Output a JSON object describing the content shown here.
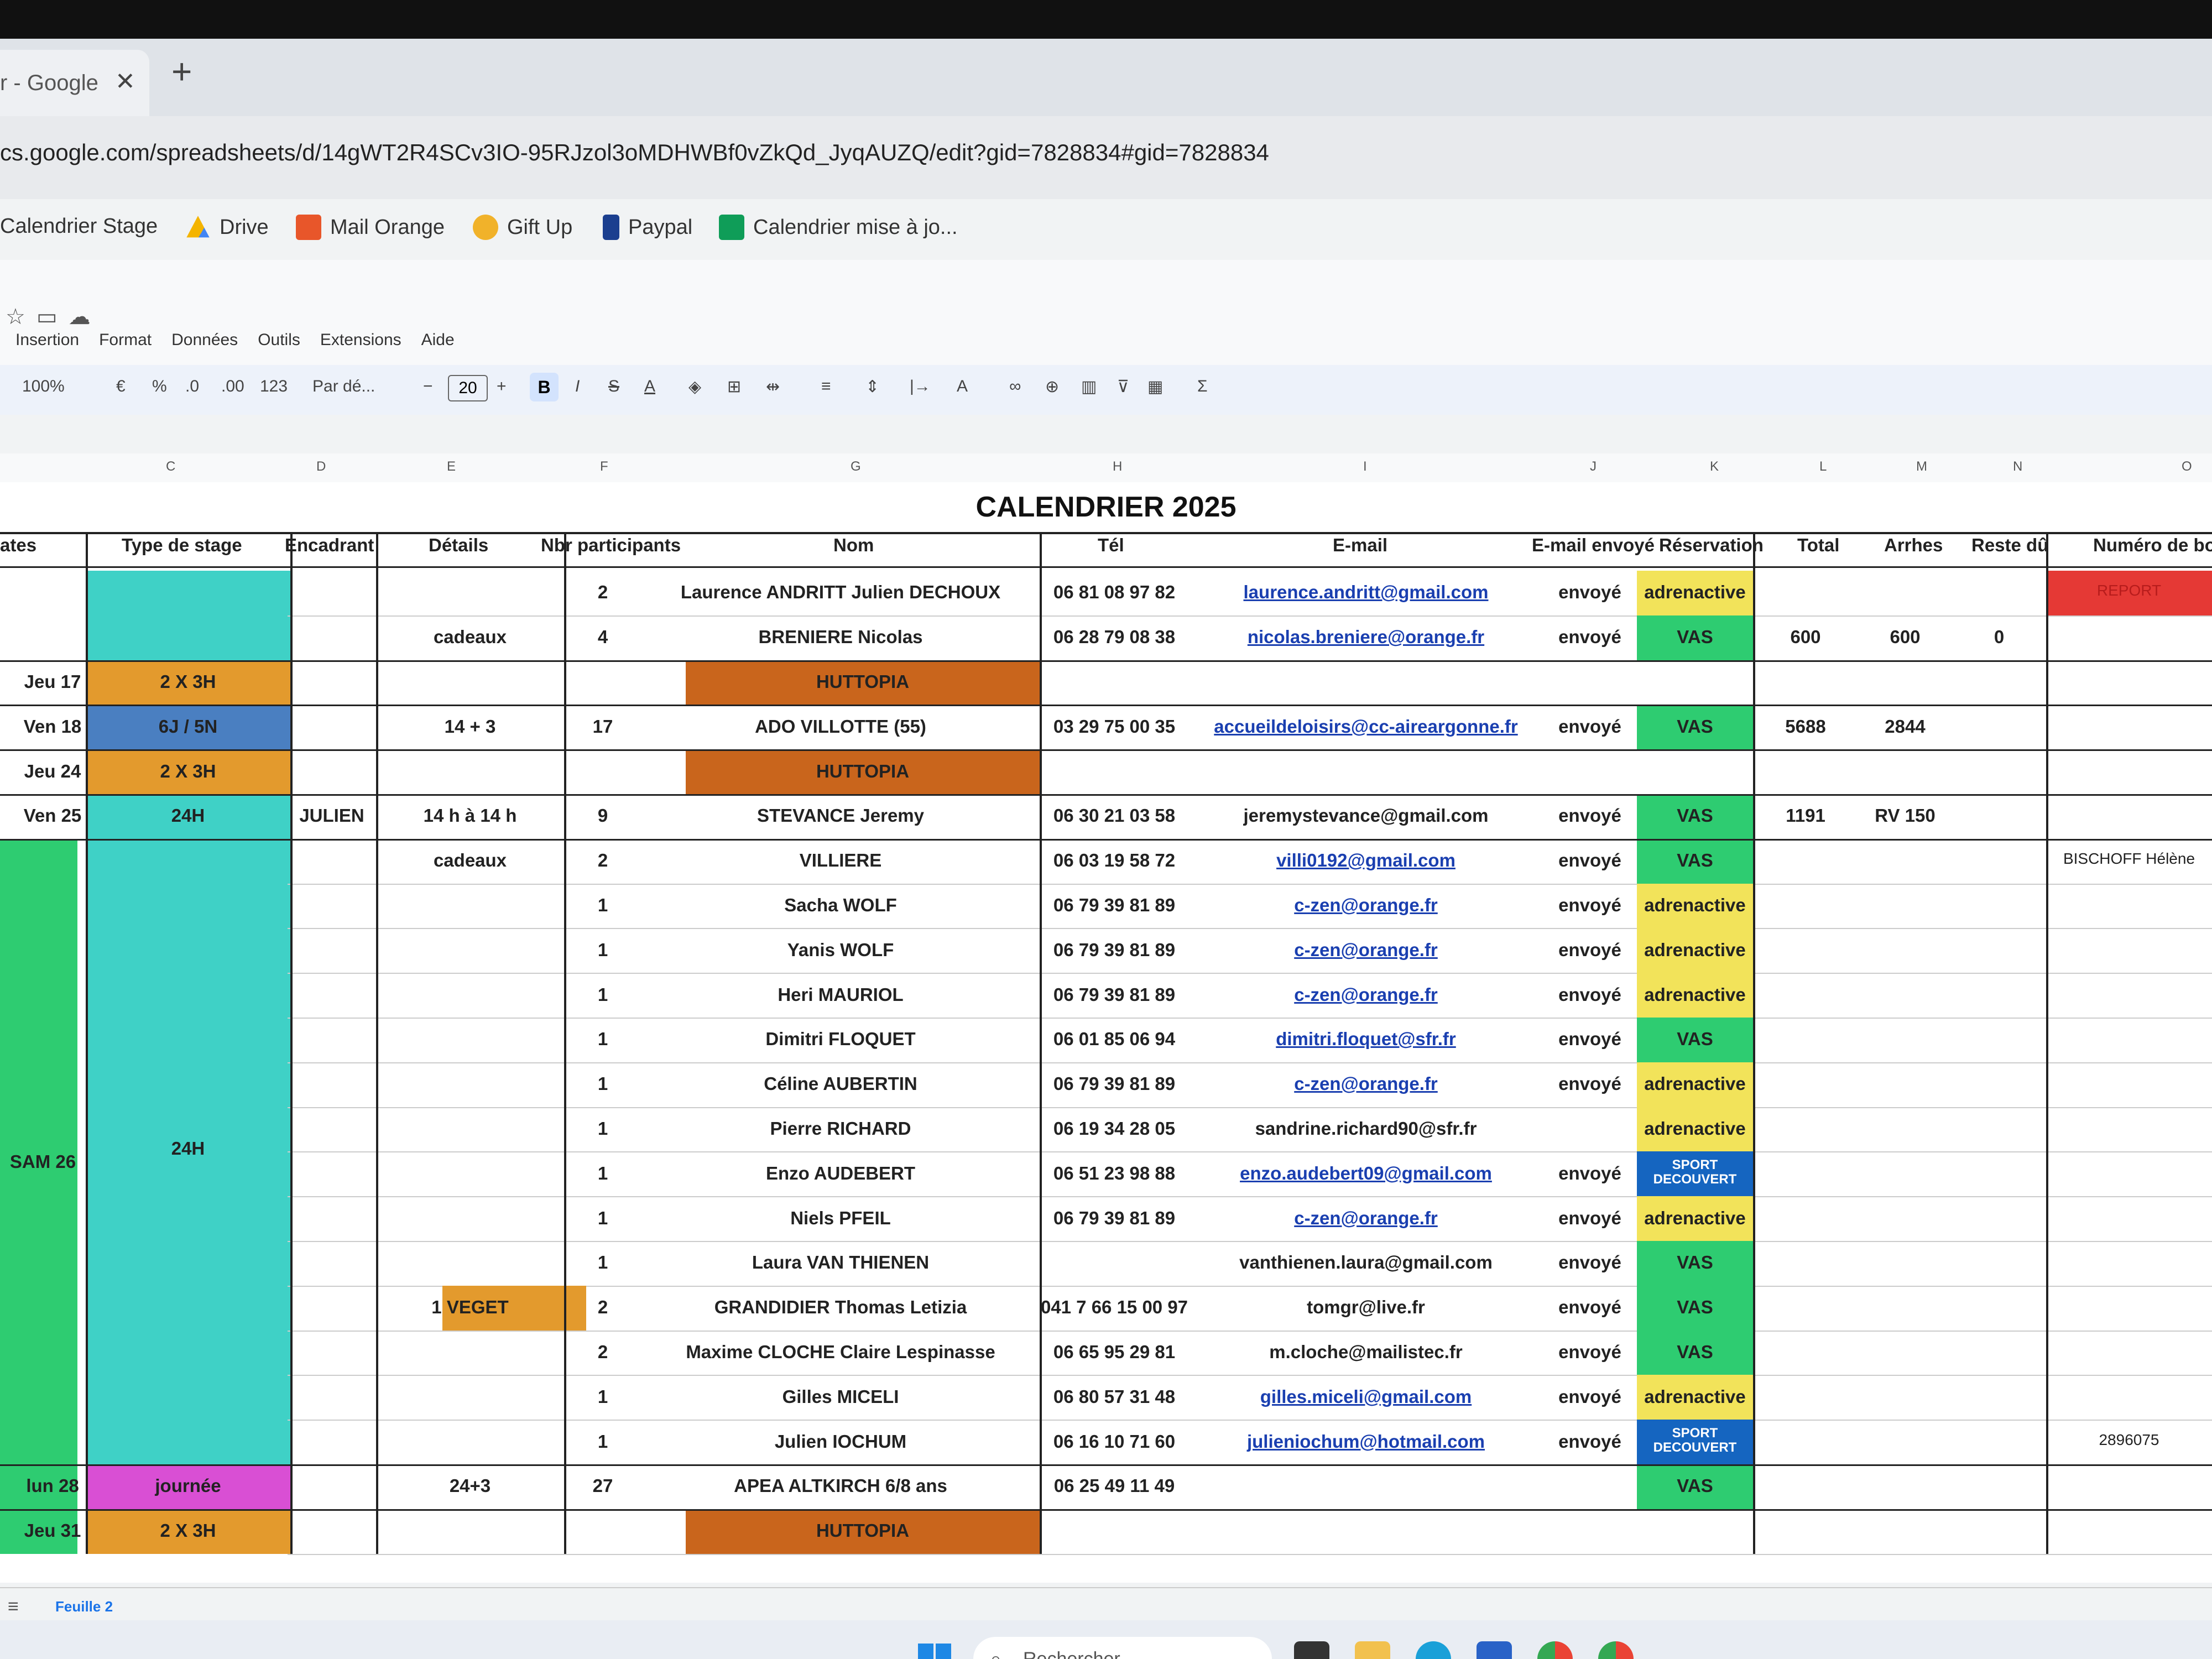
{
  "browser": {
    "tab_title": "r - Google",
    "tab_close": "✕",
    "new_tab": "+",
    "url": "cs.google.com/spreadsheets/d/14gWT2R4SCv3IO-95RJzol3oMDHWBf0vZkQd_JyqAUZQ/edit?gid=7828834#gid=7828834",
    "bookmarks": [
      "Calendrier Stage",
      "Drive",
      "Mail Orange",
      "Gift Up",
      "Paypal",
      "Calendrier mise à jo..."
    ]
  },
  "sheets": {
    "menus": [
      "Insertion",
      "Format",
      "Données",
      "Outils",
      "Extensions",
      "Aide"
    ],
    "toolbar": {
      "zoom": "100%",
      "currency": "€",
      "percent": "%",
      "dec_less": ".0",
      "dec_more": ".00",
      "number_format": "123",
      "font": "Par dé...",
      "minus": "−",
      "font_size": "20",
      "plus": "+",
      "bold": "B",
      "italic": "I",
      "strike": "S",
      "textcolor": "A",
      "sigma": "Σ"
    },
    "column_letters": [
      "C",
      "D",
      "E",
      "F",
      "G",
      "H",
      "I",
      "J",
      "K",
      "L",
      "M",
      "N",
      "O"
    ],
    "title": "CALENDRIER 2025",
    "headers": {
      "dates": "ates",
      "type": "Type de stage",
      "encadrant": "Encadrant",
      "details": "Détails",
      "nbr": "Nbr participants",
      "nom": "Nom",
      "tel": "Tél",
      "email": "E-mail",
      "envoye": "E-mail envoyé",
      "reservation": "Réservation",
      "total": "Total",
      "arrhes": "Arrhes",
      "reste": "Reste dû",
      "bon": "Numéro de bon"
    },
    "rows": [
      {
        "nbr": "2",
        "nom": "Laurence ANDRITT Julien DECHOUX",
        "tel": "06 81 08 97 82",
        "email": "laurence.andritt@gmail.com",
        "envoye": "envoyé",
        "resa": "adrenactive",
        "bon": "REPORT"
      },
      {
        "details": "cadeaux",
        "nbr": "4",
        "nom": "BRENIERE Nicolas",
        "tel": "06 28 79 08 38",
        "email": "nicolas.breniere@orange.fr",
        "envoye": "envoyé",
        "resa": "VAS",
        "total": "600",
        "arrhes": "600",
        "reste": "0"
      },
      {
        "date": "Jeu 17",
        "type": "2 X 3H",
        "nom": "HUTTOPIA"
      },
      {
        "date": "Ven 18",
        "type": "6J / 5N",
        "details": "14 + 3",
        "nbr": "17",
        "nom": "ADO VILLOTTE (55)",
        "tel": "03 29 75 00 35",
        "email": "accueildeloisirs@cc-aireargonne.fr",
        "envoye": "envoyé",
        "resa": "VAS",
        "total": "5688",
        "arrhes": "2844"
      },
      {
        "date": "Jeu 24",
        "type": "2 X 3H",
        "nom": "HUTTOPIA"
      },
      {
        "date": "Ven 25",
        "type": "24H",
        "encadrant": "JULIEN",
        "details": "14 h à 14 h",
        "nbr": "9",
        "nom": "STEVANCE Jeremy",
        "tel": "06 30 21 03 58",
        "email": "jeremystevance@gmail.com",
        "envoye": "envoyé",
        "resa": "VAS",
        "total": "1191",
        "arrhes": "RV 150"
      },
      {
        "details": "cadeaux",
        "nbr": "2",
        "nom": "VILLIERE",
        "tel": "06 03 19 58 72",
        "email": "villi0192@gmail.com",
        "envoye": "envoyé",
        "resa": "VAS",
        "bon": "BISCHOFF Hélène"
      },
      {
        "nbr": "1",
        "nom": "Sacha WOLF",
        "tel": "06 79 39 81 89",
        "email": "c-zen@orange.fr",
        "envoye": "envoyé",
        "resa": "adrenactive"
      },
      {
        "nbr": "1",
        "nom": "Yanis WOLF",
        "tel": "06 79 39 81 89",
        "email": "c-zen@orange.fr",
        "envoye": "envoyé",
        "resa": "adrenactive"
      },
      {
        "nbr": "1",
        "nom": "Heri MAURIOL",
        "tel": "06 79 39 81 89",
        "email": "c-zen@orange.fr",
        "envoye": "envoyé",
        "resa": "adrenactive"
      },
      {
        "nbr": "1",
        "nom": "Dimitri FLOQUET",
        "tel": "06 01 85 06 94",
        "email": "dimitri.floquet@sfr.fr",
        "envoye": "envoyé",
        "resa": "VAS"
      },
      {
        "nbr": "1",
        "nom": "Céline AUBERTIN",
        "tel": "06 79 39 81 89",
        "email": "c-zen@orange.fr",
        "envoye": "envoyé",
        "resa": "adrenactive"
      },
      {
        "nbr": "1",
        "nom": "Pierre RICHARD",
        "tel": "06 19 34 28 05",
        "email": "sandrine.richard90@sfr.fr",
        "resa": "adrenactive"
      },
      {
        "nbr": "1",
        "nom": "Enzo AUDEBERT",
        "tel": "06 51 23 98 88",
        "email": "enzo.audebert09@gmail.com",
        "envoye": "envoyé",
        "resa": "SPORT DECOUVERT"
      },
      {
        "nbr": "1",
        "nom": "Niels  PFEIL",
        "tel": "06 79 39 81 89",
        "email": "c-zen@orange.fr",
        "envoye": "envoyé",
        "resa": "adrenactive"
      },
      {
        "nbr": "1",
        "nom": "Laura VAN THIENEN",
        "email": "vanthienen.laura@gmail.com",
        "envoye": "envoyé",
        "resa": "VAS"
      },
      {
        "details": "1 VEGET",
        "nbr": "2",
        "nom": "GRANDIDIER Thomas Letizia",
        "tel": "041 7 66 15 00 97",
        "email": "tomgr@live.fr",
        "envoye": "envoyé",
        "resa": "VAS"
      },
      {
        "nbr": "2",
        "nom": "Maxime CLOCHE Claire Lespinasse",
        "tel": "06 65 95 29 81",
        "email": "m.cloche@mailistec.fr",
        "envoye": "envoyé",
        "resa": "VAS"
      },
      {
        "nbr": "1",
        "nom": "Gilles MICELI",
        "tel": "06 80 57 31 48",
        "email": "gilles.miceli@gmail.com",
        "envoye": "envoyé",
        "resa": "adrenactive"
      },
      {
        "nbr": "1",
        "nom": "Julien IOCHUM",
        "tel": "06 16 10 71 60",
        "email": "julieniochum@hotmail.com",
        "envoye": "envoyé",
        "resa": "SPORT DECOUVERT",
        "bon": "2896075"
      },
      {
        "date": "lun 28",
        "type": "journée",
        "details": "24+3",
        "nbr": "27",
        "nom": "APEA ALTKIRCH 6/8 ans",
        "tel": "06 25 49 11 49",
        "resa": "VAS"
      },
      {
        "date": "Jeu 31",
        "type": "2 X 3H",
        "nom": "HUTTOPIA"
      }
    ],
    "merged": {
      "sam26_date": "SAM 26",
      "sam26_type": "24H"
    },
    "sheet_tab": "Feuille 2",
    "colors": {
      "turquoise": "#3fd1c6",
      "orange": "#e39a2d",
      "blue": "#4a7fc1",
      "green": "#2ecc71",
      "huttopia": "#c9651c",
      "yellow": "#f2e35a",
      "magenta": "#d94fd4",
      "red": "#e53935",
      "navy": "#1565c0"
    }
  },
  "taskbar": {
    "search": "Rechercher"
  }
}
